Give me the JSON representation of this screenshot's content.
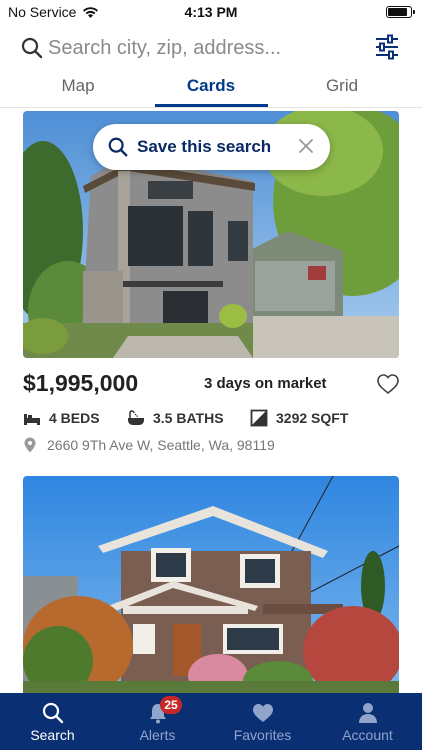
{
  "status_bar": {
    "carrier": "No Service",
    "time": "4:13 PM",
    "battery_level": 0.85
  },
  "search": {
    "placeholder": "Search city, zip, address...",
    "value": ""
  },
  "tabs": [
    {
      "label": "Map",
      "active": false
    },
    {
      "label": "Cards",
      "active": true
    },
    {
      "label": "Grid",
      "active": false
    }
  ],
  "save_search": {
    "label": "Save this search"
  },
  "listings": [
    {
      "price": "$1,995,000",
      "days_on_market": "3 days on market",
      "beds": "4 BEDS",
      "baths": "3.5 BATHS",
      "sqft": "3292 SQFT",
      "address": "2660 9Th Ave W, Seattle, Wa, 98119",
      "favorited": false
    },
    {
      "price": "",
      "days_on_market": "",
      "beds": "",
      "baths": "",
      "sqft": "",
      "address": ""
    }
  ],
  "bottom_nav": [
    {
      "label": "Search",
      "icon": "search-icon",
      "active": true
    },
    {
      "label": "Alerts",
      "icon": "bell-icon",
      "active": false,
      "badge": "25"
    },
    {
      "label": "Favorites",
      "icon": "heart-icon",
      "active": false
    },
    {
      "label": "Account",
      "icon": "person-icon",
      "active": false
    }
  ],
  "colors": {
    "brand_navy": "#0b2f73",
    "active_tab": "#003a8c",
    "badge_red": "#c62828"
  }
}
